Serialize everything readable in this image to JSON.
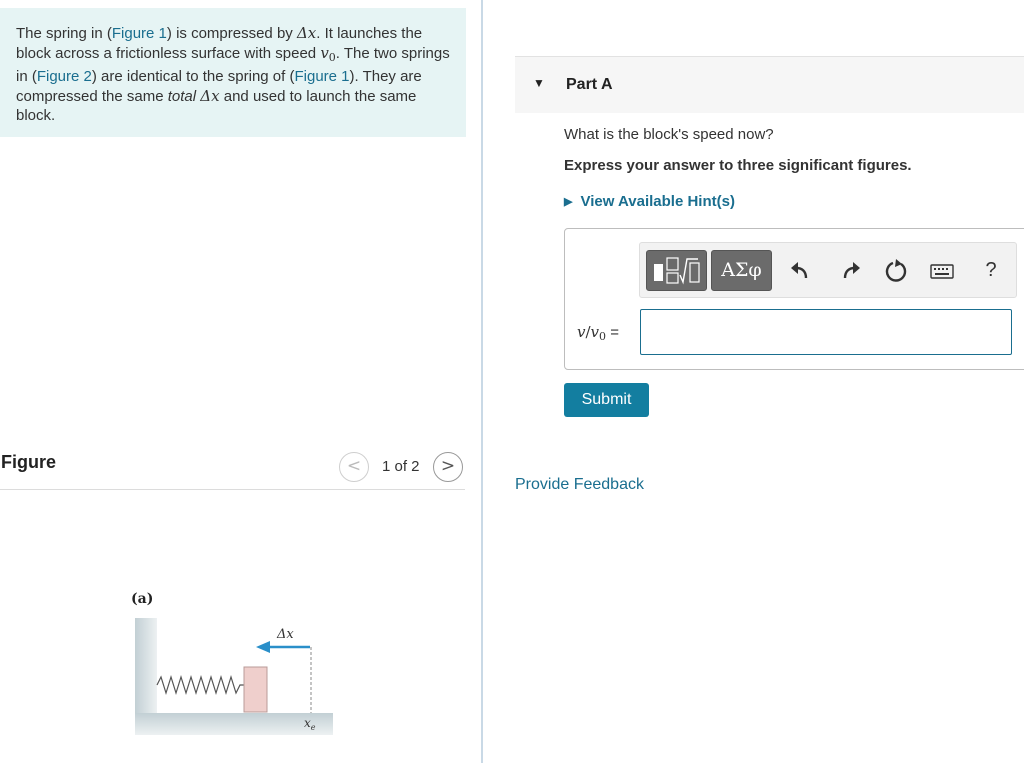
{
  "problem": {
    "p1": "The spring in (",
    "fig1_link": "Figure 1",
    "p2": ") is compressed by ",
    "delta_x": "Δx",
    "p3": ". It launches the block across a frictionless surface with speed ",
    "v0_main": "v",
    "v0_sub": "0",
    "p4": ". The two springs in (",
    "fig2_link": "Figure 2",
    "p5": ") are identical to the spring of (",
    "fig1b_link": "Figure 1",
    "p6": "). They are compressed the same ",
    "total": "total",
    "p7": " and used to launch the same block."
  },
  "figure": {
    "title": "Figure",
    "counter": "1 of 2",
    "prev_glyph": "<",
    "next_glyph": ">",
    "panel_label": "(a)",
    "delta_label": "Δx",
    "xe_main": "x",
    "xe_sub": "e"
  },
  "part": {
    "caret": "▼",
    "title": "Part A",
    "question": "What is the block's speed now?",
    "instruction": "Express your answer to three significant figures.",
    "hint_caret": "▶",
    "hint_label": "View Available Hint(s)"
  },
  "answer": {
    "label_v": "v",
    "label_slash": "/",
    "label_v0": "v",
    "label_v0_sub": "0",
    "label_eq": " =",
    "value": "",
    "greek_label": "ΑΣφ",
    "help_label": "?"
  },
  "submit_label": "Submit",
  "feedback_label": "Provide Feedback",
  "colors": {
    "accent": "#137ea0",
    "link": "#1a6e8f",
    "problem_bg": "#e6f4f4",
    "arrow": "#2a8fc9",
    "block": "#efcfcc"
  }
}
